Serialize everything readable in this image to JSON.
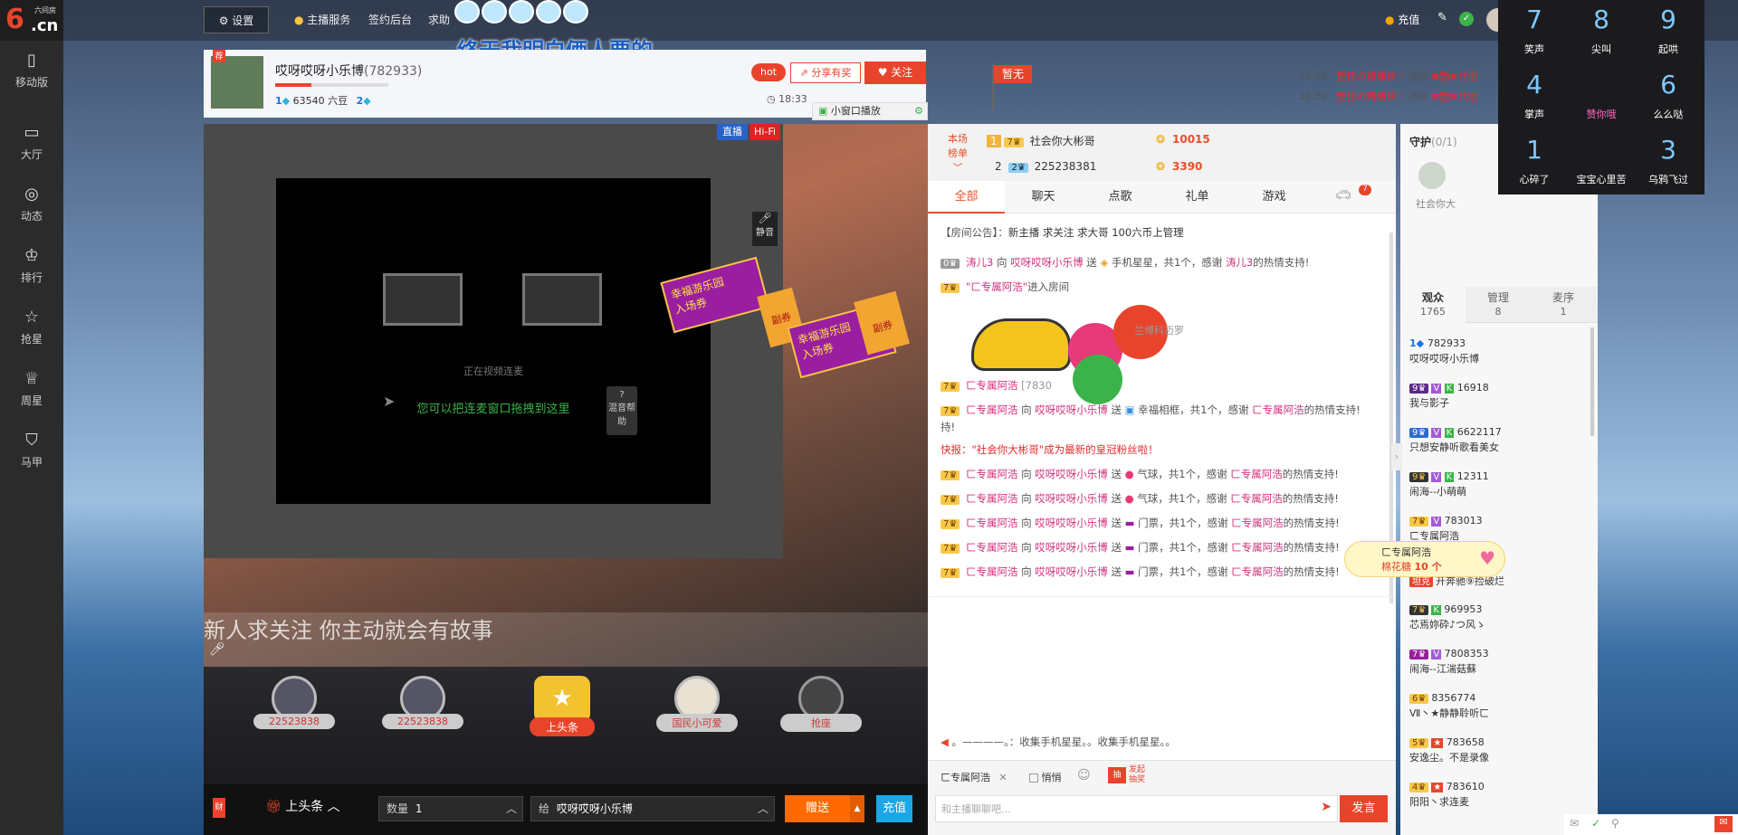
{
  "logo": {
    "num": "6",
    "cn": ".cn",
    "sub": "六间房"
  },
  "leftnav": [
    {
      "label": "移动版",
      "icon": "mobile-icon"
    },
    {
      "label": "大厅",
      "icon": "tv-icon"
    },
    {
      "label": "动态",
      "icon": "compass-icon"
    },
    {
      "label": "排行",
      "icon": "crown-icon"
    },
    {
      "label": "抢星",
      "icon": "star-icon"
    },
    {
      "label": "周星",
      "icon": "cup-icon"
    },
    {
      "label": "马甲",
      "icon": "shirt-icon"
    }
  ],
  "topbar": {
    "settings": "设置",
    "links": [
      "主播服务",
      "签约后台",
      "求助"
    ],
    "banner_text": "终于我明白俩人要的",
    "recharge": "充值"
  },
  "anchor": {
    "name": "哎呀哎呀小乐博",
    "id": "(782933)",
    "level_left": "1",
    "beans": "63540 六豆",
    "level_right": "2",
    "hot": "hot",
    "share": "分享有奖",
    "follow": "关注",
    "time": "18:33",
    "mini_window": "小窗口播放",
    "flag_text": "暂无"
  },
  "gift_feed": [
    {
      "time": "19:59",
      "from": "艷佳の猪猪侠♡",
      "verb": "送给",
      "to": "≡艷≡代语"
    },
    {
      "time": "19:59",
      "from": "艷佳の猪猪侠♡",
      "verb": "送给",
      "to": "≡艷≡代语"
    }
  ],
  "video": {
    "badge_live": "直播",
    "badge_hifi": "Hi-Fi",
    "mute": "静音",
    "connecting": "正在视频连麦",
    "drag_hint": "您可以把连麦窗口拖拽到这里",
    "help": "混音帮助",
    "stage_text": "新人求关注  你主动就会有故事",
    "ticket": "入场券",
    "ticket_sub": "副券",
    "ticket_title": "幸福游乐园"
  },
  "seats": [
    {
      "label": "22523838"
    },
    {
      "label": "22523838"
    },
    {
      "label": "上头条"
    },
    {
      "label": "国民小可爱"
    },
    {
      "label": "抢座"
    }
  ],
  "giftbar": {
    "fortune": "财",
    "headline": "上头条",
    "qty_label": "数量",
    "qty_value": "1",
    "to_label": "给",
    "to_value": "哎呀哎呀小乐博",
    "give": "赠送",
    "recharge": "充值"
  },
  "rank": {
    "label1": "本场",
    "label2": "榜单",
    "rows": [
      {
        "pos": "1",
        "name": "社会你大彬哥",
        "score": "10015"
      },
      {
        "pos": "2",
        "name": "225238381",
        "score": "3390"
      }
    ]
  },
  "chat_tabs": [
    "全部",
    "聊天",
    "点歌",
    "礼单",
    "游戏"
  ],
  "chat_tab_badge": "7",
  "chat": {
    "notice_label": "【房间公告】：",
    "notice": "新主播 求关注 求大哥 100六币上管理",
    "lines": [
      {
        "who": "涛儿3",
        "verb": "向",
        "to": "哎呀哎呀小乐博",
        "act": "送",
        "gift": "手机星星，共1个，感谢",
        "thanks": "涛儿3",
        "tail": "的热情支持!"
      },
      {
        "who": "\"ㄈ专属阿浩\"",
        "verb": "",
        "to": "",
        "act": "",
        "gift": "进入房间",
        "thanks": "",
        "tail": ""
      },
      {
        "who": "ㄈ专属阿浩",
        "verb": "",
        "to": "",
        "act": "",
        "gift": "[7830",
        "thanks": "",
        "tail": ""
      },
      {
        "who": "ㄈ专属阿浩",
        "verb": "向",
        "to": "哎呀哎呀小乐博",
        "act": "送",
        "gift": "幸福相框，共1个，感谢",
        "thanks": "ㄈ专属阿浩",
        "tail": "的热情支持!"
      },
      {
        "who": "ㄈ专属阿浩",
        "verb": "向",
        "to": "哎呀哎呀小乐博",
        "act": "送",
        "gift": "气球，共1个，感谢",
        "thanks": "ㄈ专属阿浩",
        "tail": "的热情支持!"
      },
      {
        "who": "ㄈ专属阿浩",
        "verb": "向",
        "to": "哎呀哎呀小乐博",
        "act": "送",
        "gift": "气球，共1个，感谢",
        "thanks": "ㄈ专属阿浩",
        "tail": "的热情支持!"
      },
      {
        "who": "ㄈ专属阿浩",
        "verb": "向",
        "to": "哎呀哎呀小乐博",
        "act": "送",
        "gift": "门票，共1个，感谢",
        "thanks": "ㄈ专属阿浩",
        "tail": "的热情支持!"
      },
      {
        "who": "ㄈ专属阿浩",
        "verb": "向",
        "to": "哎呀哎呀小乐博",
        "act": "送",
        "gift": "门票，共1个，感谢",
        "thanks": "ㄈ专属阿浩",
        "tail": "的热情支持!"
      },
      {
        "who": "ㄈ专属阿浩",
        "verb": "向",
        "to": "哎呀哎呀小乐博",
        "act": "送",
        "gift": "门票，共1个，感谢",
        "thanks": "ㄈ专属阿浩",
        "tail": "的热情支持!"
      }
    ],
    "flash": "快报：\"社会你大彬哥\"成为最新的皇冠粉丝啦！",
    "line3_tail": "持!",
    "car_name": "兰博科迈罗",
    "ticker": "。————。：收集手机星星。。收集手机星星。。"
  },
  "composer": {
    "to": "ㄈ专属阿浩",
    "whisper": "悄悄",
    "lottery": "发起抽奖",
    "placeholder": "和主播聊聊吧...",
    "send": "发言"
  },
  "guard": {
    "title": "守护",
    "count": "(0/1)",
    "name": "社会你大"
  },
  "aud_tabs": [
    {
      "label": "观众",
      "count": "1765"
    },
    {
      "label": "管理",
      "count": "8"
    },
    {
      "label": "麦序",
      "count": "1"
    }
  ],
  "audience": [
    {
      "id": "782933",
      "name": "哎呀哎呀小乐博"
    },
    {
      "id": "16918",
      "name": "我与影子"
    },
    {
      "id": "6622117",
      "name": "只想安静听歌看美女"
    },
    {
      "id": "12311",
      "name": "闹海--小萌萌"
    },
    {
      "id": "783013",
      "name": "ㄈ专属阿浩"
    },
    {
      "id": "",
      "name": "开奔驰⑨捡破烂"
    },
    {
      "id": "969953",
      "name": "芯焉妳砕♪つ风ゝ"
    },
    {
      "id": "7808353",
      "name": "闹海--江湍菇蘇"
    },
    {
      "id": "8356774",
      "name": "Ⅶ丶★静静聆听ㄈ"
    },
    {
      "id": "783658",
      "name": "安逸尘。不是录像"
    },
    {
      "id": "783610",
      "name": "阳阳丶求连麦"
    }
  ],
  "popup": {
    "name": "ㄈ专属阿浩",
    "gift": "棉花糖",
    "count": "10 个"
  },
  "palette": [
    {
      "num": "7",
      "label": "笑声"
    },
    {
      "num": "8",
      "label": "尖叫"
    },
    {
      "num": "9",
      "label": "起哄"
    },
    {
      "num": "4",
      "label": "掌声"
    },
    {
      "num": "",
      "label": "赞你哦"
    },
    {
      "num": "6",
      "label": "么么哒"
    },
    {
      "num": "1",
      "label": "心碎了"
    },
    {
      "num": "",
      "label": "宝宝心里苦"
    },
    {
      "num": "3",
      "label": "乌鸦飞过"
    }
  ]
}
